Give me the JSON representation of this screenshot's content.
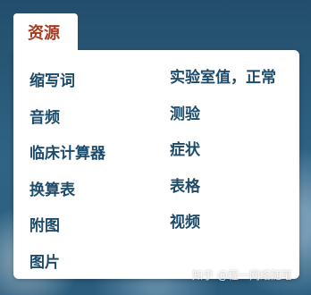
{
  "tab": {
    "label": "资源"
  },
  "menu": {
    "left_items": [
      {
        "label": "缩写词"
      },
      {
        "label": "音频"
      },
      {
        "label": "临床计算器"
      },
      {
        "label": "换算表"
      },
      {
        "label": "附图"
      },
      {
        "label": "图片"
      }
    ],
    "right_items": [
      {
        "label": "实验室值，正常"
      },
      {
        "label": "测验"
      },
      {
        "label": "症状"
      },
      {
        "label": "表格"
      },
      {
        "label": "视频"
      }
    ]
  },
  "watermark": {
    "text": "知乎 @程一网络随笔"
  },
  "colors": {
    "tab_text": "#a73a1f",
    "item_text": "#1c4b6b",
    "background": "#2b5a79"
  }
}
